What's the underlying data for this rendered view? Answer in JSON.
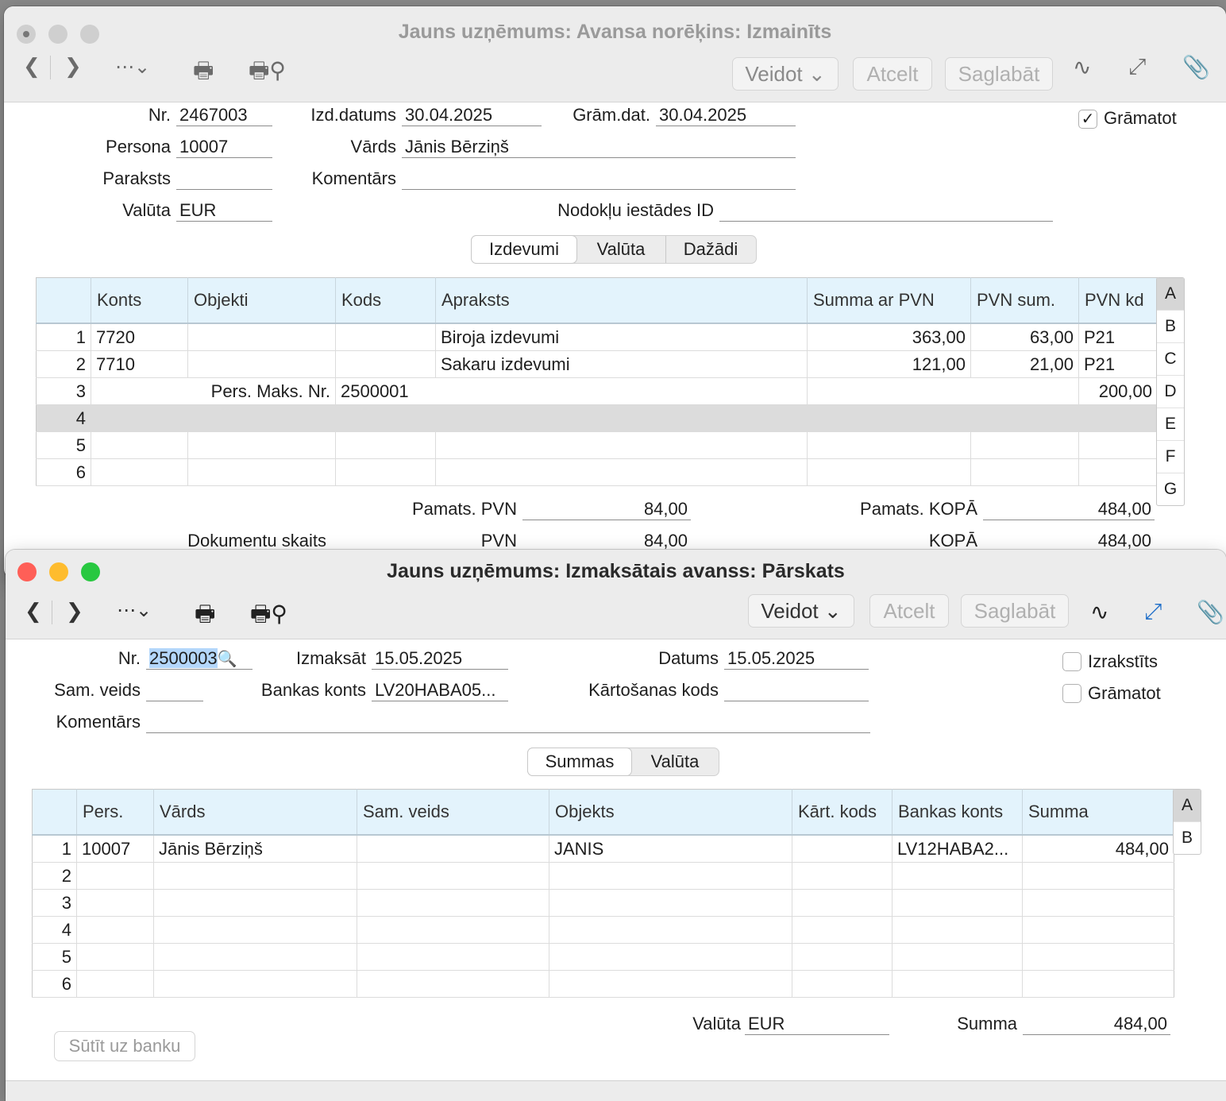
{
  "w1": {
    "title": "Jauns uzņēmums: Avansa norēķins: Izmainīts",
    "toolbar": {
      "veidot": "Veidot",
      "atcelt": "Atcelt",
      "saglabat": "Saglabāt"
    },
    "form": {
      "nr_label": "Nr.",
      "nr": "2467003",
      "izd_label": "Izd.datums",
      "izd": "30.04.2025",
      "gram_label": "Grām.dat.",
      "gram": "30.04.2025",
      "persona_label": "Persona",
      "persona": "10007",
      "vards_label": "Vārds",
      "vards": "Jānis Bērziņš",
      "paraksts_label": "Paraksts",
      "paraksts": "",
      "komentars_label": "Komentārs",
      "komentars": "",
      "valuta_label": "Valūta",
      "valuta": "EUR",
      "nodoklu_label": "Nodokļu iestādes ID",
      "nodoklu": "",
      "gramatot_label": "Grāmatot",
      "gramatot_mark": "✓"
    },
    "tabs": [
      "Izdevumi",
      "Valūta",
      "Dažādi"
    ],
    "columns": [
      "Konts",
      "Objekti",
      "Kods",
      "Apraksts",
      "Summa ar PVN",
      "PVN sum.",
      "PVN kd"
    ],
    "rows": [
      {
        "n": "1",
        "konts": "7720",
        "objekti": "",
        "kods": "",
        "apraksts": "Biroja izdevumi",
        "summa": "363,00",
        "pvn": "63,00",
        "kd": "P21"
      },
      {
        "n": "2",
        "konts": "7710",
        "objekti": "",
        "kods": "",
        "apraksts": "Sakaru izdevumi",
        "summa": "121,00",
        "pvn": "21,00",
        "kd": "P21"
      }
    ],
    "row3": {
      "n": "3",
      "label": "Pers. Maks. Nr.",
      "value": "2500001",
      "amount": "200,00"
    },
    "empty_rows": [
      "4",
      "5",
      "6"
    ],
    "letters": [
      "A",
      "B",
      "C",
      "D",
      "E",
      "F",
      "G"
    ],
    "totals": {
      "pamats_pvn_label": "Pamats. PVN",
      "pamats_pvn": "84,00",
      "pamats_kopa_label": "Pamats. KOPĀ",
      "pamats_kopa": "484,00",
      "dok_label": "Dokumentu skaits",
      "pvn_label": "PVN",
      "pvn": "84,00",
      "kopa_label": "KOPĀ",
      "kopa": "484,00"
    }
  },
  "w2": {
    "title": "Jauns uzņēmums: Izmaksātais avanss: Pārskats",
    "toolbar": {
      "veidot": "Veidot",
      "atcelt": "Atcelt",
      "saglabat": "Saglabāt"
    },
    "form": {
      "nr_label": "Nr.",
      "nr": "2500003",
      "izmaksat_label": "Izmaksāt",
      "izmaksat": "15.05.2025",
      "datums_label": "Datums",
      "datums": "15.05.2025",
      "samveids_label": "Sam. veids",
      "samveids": "",
      "bankas_label": "Bankas konts",
      "bankas": "LV20HABA05...",
      "kart_label": "Kārtošanas kods",
      "kart": "",
      "komentars_label": "Komentārs",
      "komentars": "",
      "izrakstits_label": "Izrakstīts",
      "gramatot_label": "Grāmatot"
    },
    "tabs": [
      "Summas",
      "Valūta"
    ],
    "columns": [
      "Pers.",
      "Vārds",
      "Sam. veids",
      "Objekts",
      "Kārt. kods",
      "Bankas konts",
      "Summa"
    ],
    "rows": [
      {
        "n": "1",
        "pers": "10007",
        "vards": "Jānis Bērziņš",
        "sam": "",
        "objekts": "JANIS",
        "kart": "",
        "bankas": "LV12HABA2...",
        "summa": "484,00"
      }
    ],
    "empty_rows": [
      "2",
      "3",
      "4",
      "5",
      "6"
    ],
    "letters": [
      "A",
      "B"
    ],
    "totals": {
      "valuta_label": "Valūta",
      "valuta": "EUR",
      "summa_label": "Summa",
      "summa": "484,00"
    },
    "send_label": "Sūtīt uz banku"
  },
  "colors": {
    "accent": "#e3f3fc",
    "close": "#ff5f57",
    "minimize": "#febc2e",
    "zoom": "#28c840"
  }
}
